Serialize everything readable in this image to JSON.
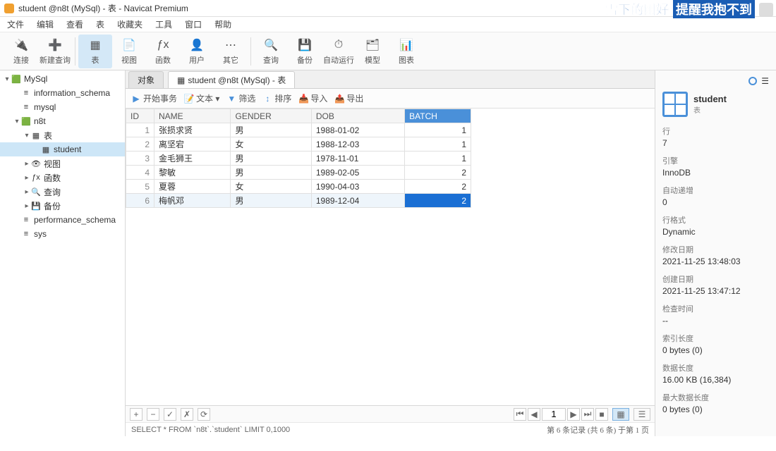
{
  "window_title": "student @n8t (MySql) - 表 - Navicat Premium",
  "watermark": {
    "w1": "雪下的刚好",
    "w2": "提醒我抱不到"
  },
  "menu": [
    "文件",
    "编辑",
    "查看",
    "表",
    "收藏夹",
    "工具",
    "窗口",
    "帮助"
  ],
  "toolbar": [
    {
      "icon": "🔌",
      "label": "连接"
    },
    {
      "icon": "➕",
      "label": "新建查询"
    },
    {
      "sep": true
    },
    {
      "icon": "▦",
      "label": "表",
      "active": true
    },
    {
      "icon": "📄",
      "label": "视图"
    },
    {
      "icon": "ƒx",
      "label": "函数"
    },
    {
      "icon": "👤",
      "label": "用户"
    },
    {
      "icon": "⋯",
      "label": "其它"
    },
    {
      "sep": true
    },
    {
      "icon": "🔍",
      "label": "查询"
    },
    {
      "icon": "💾",
      "label": "备份"
    },
    {
      "icon": "⏱",
      "label": "自动运行"
    },
    {
      "icon": "🗂",
      "label": "模型"
    },
    {
      "icon": "📊",
      "label": "图表"
    }
  ],
  "tree": [
    {
      "d": 0,
      "tw": "▾",
      "ic": "🟩",
      "t": "MySql"
    },
    {
      "d": 1,
      "tw": "",
      "ic": "≡",
      "t": "information_schema"
    },
    {
      "d": 1,
      "tw": "",
      "ic": "≡",
      "t": "mysql"
    },
    {
      "d": 1,
      "tw": "▾",
      "ic": "🟩",
      "t": "n8t"
    },
    {
      "d": 2,
      "tw": "▾",
      "ic": "▦",
      "t": "表"
    },
    {
      "d": 3,
      "tw": "",
      "ic": "▦",
      "t": "student",
      "sel": true
    },
    {
      "d": 2,
      "tw": "▸",
      "ic": "👁",
      "t": "视图"
    },
    {
      "d": 2,
      "tw": "▸",
      "ic": "ƒx",
      "t": "函数"
    },
    {
      "d": 2,
      "tw": "▸",
      "ic": "🔍",
      "t": "查询"
    },
    {
      "d": 2,
      "tw": "▸",
      "ic": "💾",
      "t": "备份"
    },
    {
      "d": 1,
      "tw": "",
      "ic": "≡",
      "t": "performance_schema"
    },
    {
      "d": 1,
      "tw": "",
      "ic": "≡",
      "t": "sys"
    }
  ],
  "tabs": [
    {
      "label": "对象"
    },
    {
      "label": "student @n8t (MySql) - 表",
      "active": true
    }
  ],
  "subbar": [
    {
      "ic": "▶",
      "t": "开始事务"
    },
    {
      "ic": "📝",
      "t": "文本 ▾"
    },
    {
      "ic": "▼",
      "t": "筛选"
    },
    {
      "ic": "↕",
      "t": "排序"
    },
    {
      "ic": "📥",
      "t": "导入"
    },
    {
      "ic": "📤",
      "t": "导出"
    }
  ],
  "columns": [
    "ID",
    "NAME",
    "GENDER",
    "DOB",
    "BATCH"
  ],
  "rows": [
    {
      "id": 1,
      "name": "张损求贤",
      "gender": "男",
      "dob": "1988-01-02",
      "batch": 1
    },
    {
      "id": 2,
      "name": "离坚宕",
      "gender": "女",
      "dob": "1988-12-03",
      "batch": 1
    },
    {
      "id": 3,
      "name": "金毛狮王",
      "gender": "男",
      "dob": "1978-11-01",
      "batch": 1
    },
    {
      "id": 4,
      "name": "黎敏",
      "gender": "男",
      "dob": "1989-02-05",
      "batch": 2
    },
    {
      "id": 5,
      "name": "夏蓉",
      "gender": "女",
      "dob": "1990-04-03",
      "batch": 2
    },
    {
      "id": 6,
      "name": "梅帆邓",
      "gender": "男",
      "dob": "1989-12-04",
      "batch": 2,
      "sel": true
    }
  ],
  "gridfoot": {
    "add": "+",
    "del": "−",
    "ok": "✓",
    "cancel": "✗",
    "refresh": "⟳",
    "page": "1"
  },
  "sql": "SELECT * FROM `n8t`.`student` LIMIT 0,1000",
  "status": "第 6 条记录 (共 6 条) 于第 1 页",
  "rpanel": {
    "title": "student",
    "sub": "表",
    "props": [
      {
        "k": "行",
        "v": "7"
      },
      {
        "k": "引擎",
        "v": "InnoDB"
      },
      {
        "k": "自动递增",
        "v": "0"
      },
      {
        "k": "行格式",
        "v": "Dynamic"
      },
      {
        "k": "修改日期",
        "v": "2021-11-25 13:48:03"
      },
      {
        "k": "创建日期",
        "v": "2021-11-25 13:47:12"
      },
      {
        "k": "检查时间",
        "v": "--"
      },
      {
        "k": "索引长度",
        "v": "0 bytes (0)"
      },
      {
        "k": "数据长度",
        "v": "16.00 KB (16,384)"
      },
      {
        "k": "最大数据长度",
        "v": "0 bytes (0)"
      }
    ]
  }
}
